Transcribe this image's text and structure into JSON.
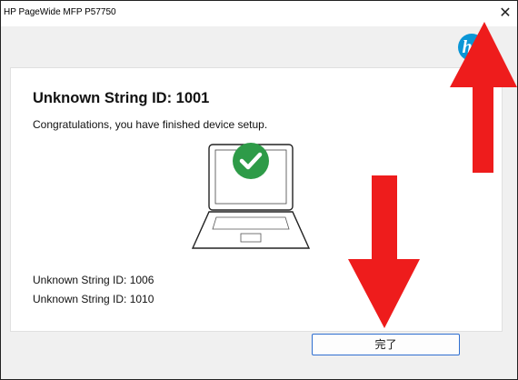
{
  "window": {
    "title": "HP PageWide MFP P57750",
    "close_glyph": "✕"
  },
  "logo": {
    "text": "hp"
  },
  "main": {
    "heading": "Unknown String ID: 1001",
    "message": "Congratulations, you have finished device setup.",
    "status_lines": [
      "Unknown String ID: 1006",
      "Unknown String ID: 1010"
    ]
  },
  "footer": {
    "finish_label": "完了"
  },
  "colors": {
    "accent": "#2f6fd0",
    "success": "#2e9b48",
    "arrow": "#ee1c1c",
    "hp_blue": "#0a96d6"
  }
}
